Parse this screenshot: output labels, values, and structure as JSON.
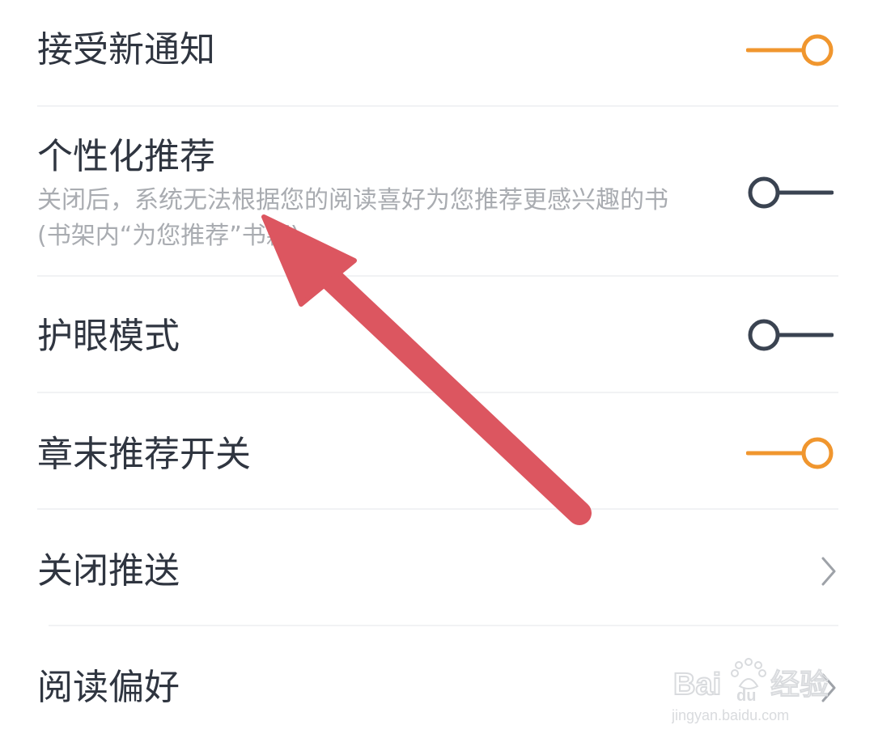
{
  "settings": {
    "items": [
      {
        "label": "接受新通知",
        "type": "toggle",
        "state": "on"
      },
      {
        "label": "个性化推荐",
        "type": "toggle",
        "state": "off",
        "description": "关闭后，系统无法根据您的阅读喜好为您推荐更感兴趣的书(书架内“为您推荐”书籍)"
      },
      {
        "label": "护眼模式",
        "type": "toggle",
        "state": "off"
      },
      {
        "label": "章末推荐开关",
        "type": "toggle",
        "state": "on"
      },
      {
        "label": "关闭推送",
        "type": "link",
        "icon": "chevron-right-icon"
      },
      {
        "label": "阅读偏好",
        "type": "link",
        "icon": "chevron-right-icon"
      }
    ]
  },
  "colors": {
    "toggle_on": "#F0962E",
    "toggle_off": "#3A4351",
    "label": "#2F3540",
    "description": "#A9ACB1",
    "annotation_arrow": "#DC5660"
  },
  "watermark": {
    "brand": "Baidu",
    "suffix": "经验",
    "url": "jingyan.baidu.com"
  }
}
